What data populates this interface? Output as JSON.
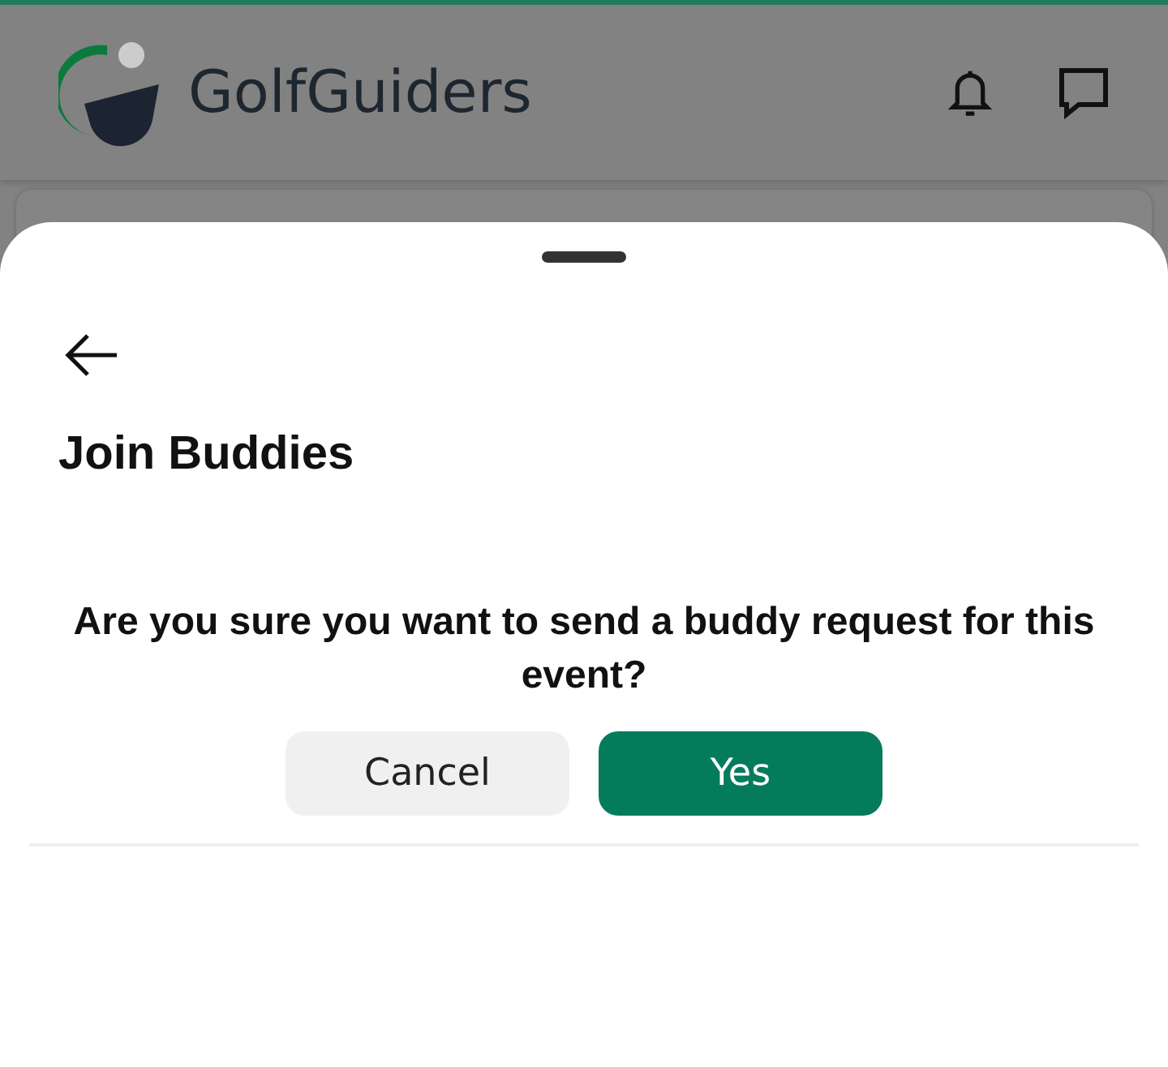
{
  "header": {
    "brand": "GolfGuiders"
  },
  "sheet": {
    "title": "Join Buddies",
    "message": "Are you sure you want to send a buddy request for this event?",
    "buttons": [
      {
        "label": "Cancel",
        "kind": "secondary"
      },
      {
        "label": "Yes",
        "kind": "primary"
      }
    ]
  }
}
